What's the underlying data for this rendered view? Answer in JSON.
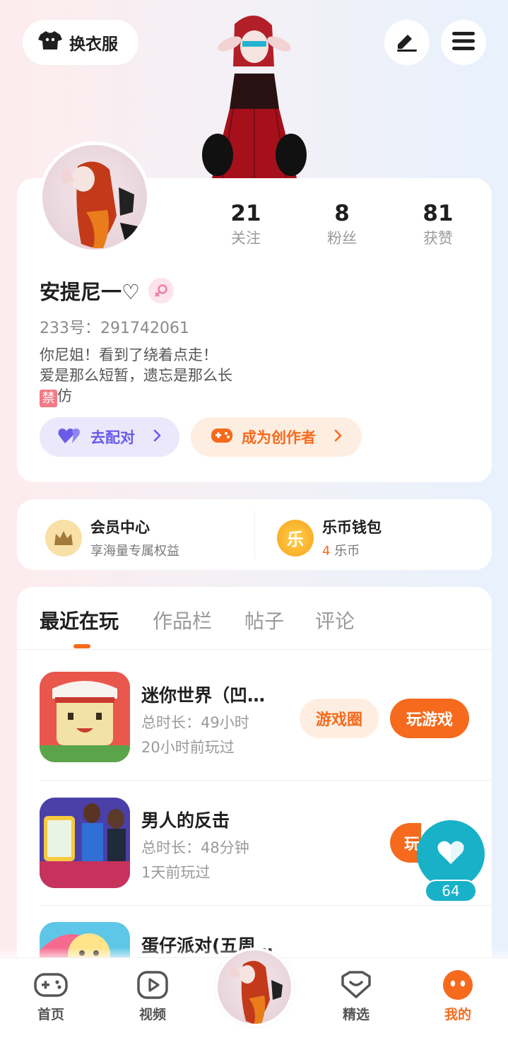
{
  "topbar": {
    "dress_label": "换衣服"
  },
  "profile": {
    "nickname": "安提尼一♡",
    "uid": "233号：291742061",
    "bio_line1": "你尼姐！看到了绕着点走！",
    "bio_line2": "爱是那么短暂，遗忘是那么长",
    "bio_ban": "禁",
    "bio_line3_rest": "仿",
    "stats": [
      {
        "num": "21",
        "label": "关注"
      },
      {
        "num": "8",
        "label": "粉丝"
      },
      {
        "num": "81",
        "label": "获赞"
      }
    ],
    "pair_label": "去配对",
    "creator_label": "成为创作者"
  },
  "member": {
    "vip_title": "会员中心",
    "vip_sub": "享海量专属权益",
    "wallet_title": "乐币钱包",
    "wallet_amount": "4",
    "wallet_unit": "乐币",
    "wallet_icon_char": "乐"
  },
  "tabs": [
    "最近在玩",
    "作品栏",
    "帖子",
    "评论"
  ],
  "games": [
    {
      "name": "迷你世界（凹…",
      "duration": "总时长：49小时",
      "last": "20小时前玩过",
      "circle_label": "游戏圈",
      "play_label": "玩游戏"
    },
    {
      "name": "男人的反击",
      "duration": "总时长：48分钟",
      "last": "1天前玩过",
      "play_label": "玩"
    },
    {
      "name": "蛋仔派对(五周…"
    }
  ],
  "like": {
    "count": "64"
  },
  "nav": [
    {
      "label": "首页"
    },
    {
      "label": "视频"
    },
    {
      "label": "精选"
    },
    {
      "label": "我的"
    }
  ],
  "colors": {
    "accent": "#f56a1c",
    "pair": "#6a5be8",
    "teal": "#18b1c8"
  }
}
